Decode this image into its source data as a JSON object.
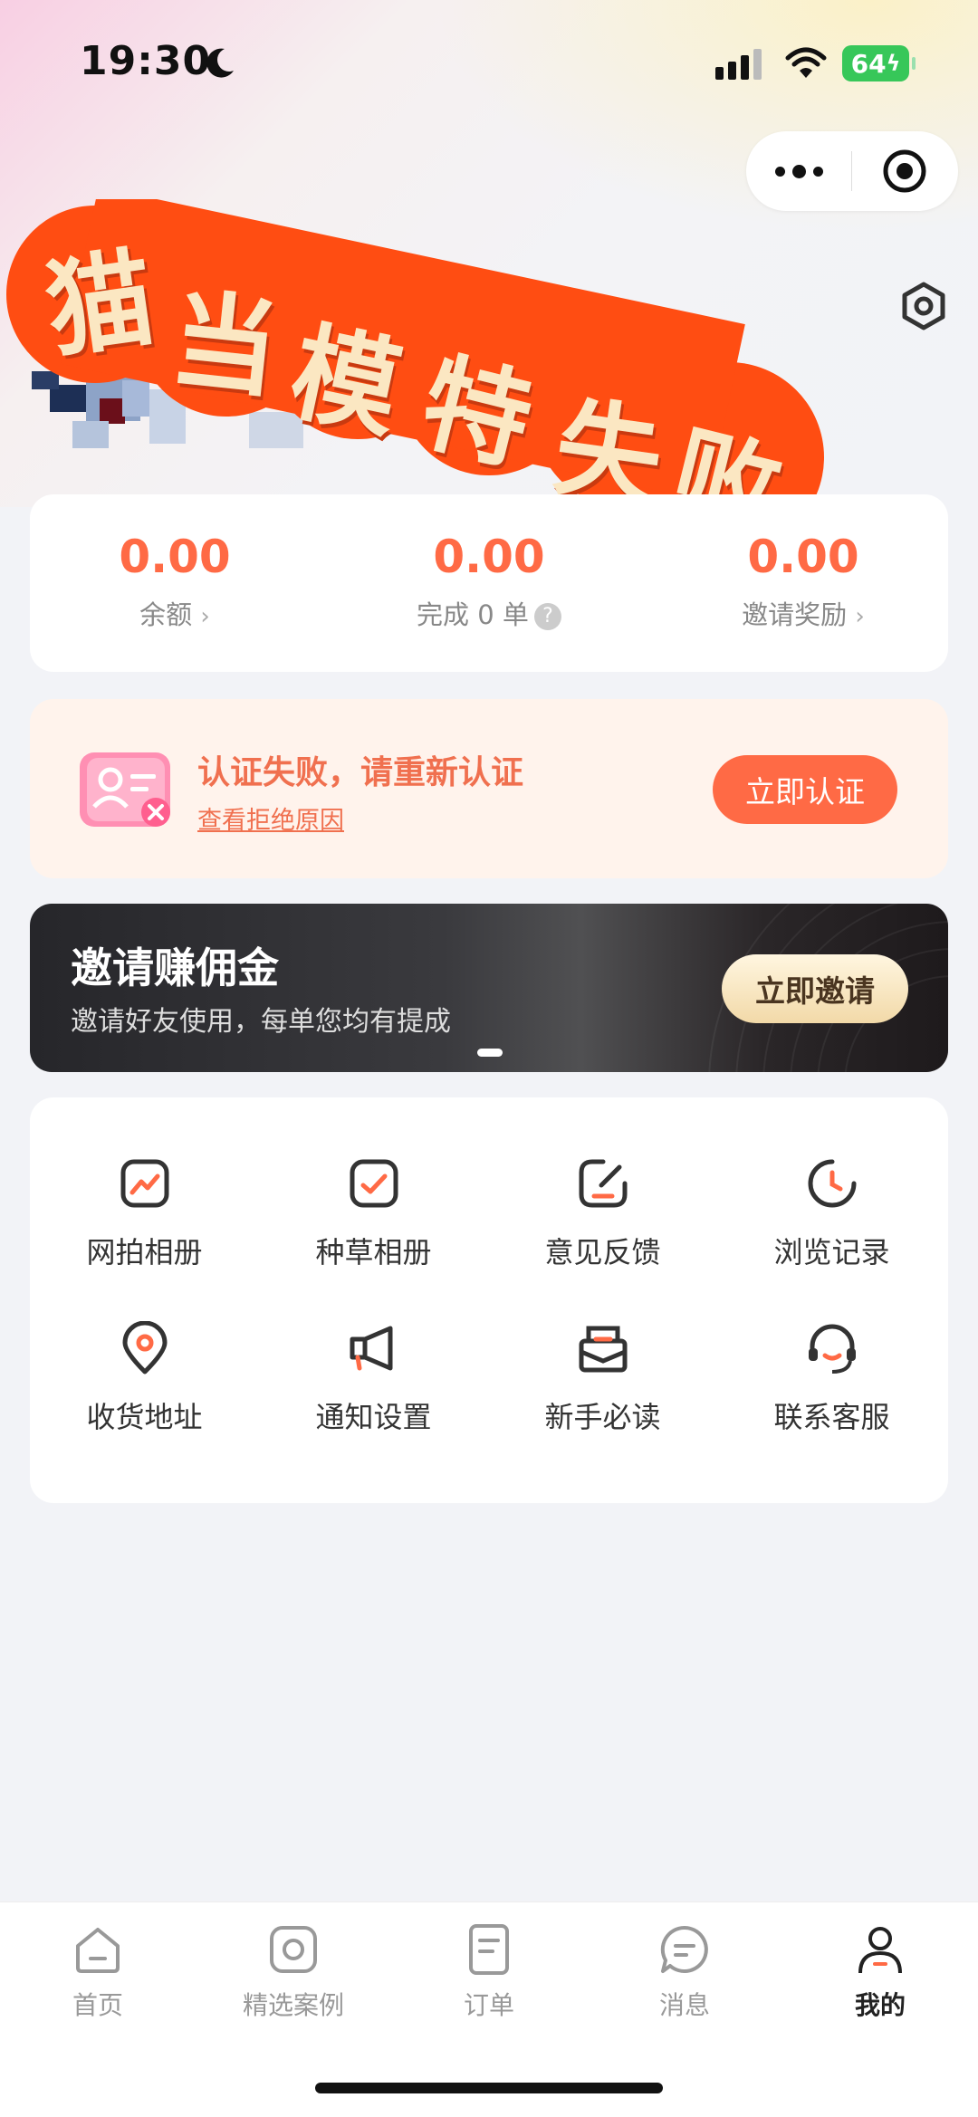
{
  "status_bar": {
    "time": "19:30",
    "battery": "64"
  },
  "capsule": {
    "more_icon": "more-dots-icon",
    "close_icon": "target-icon"
  },
  "overlay": {
    "banner_text": "猫当模特失败",
    "chars": [
      "猫",
      "当",
      "模",
      "特",
      "失",
      "败"
    ],
    "color": "#ff4d12"
  },
  "stats": [
    {
      "value": "0.00",
      "label": "余额",
      "suffix": "›"
    },
    {
      "value": "0.00",
      "label": "完成 0 单",
      "suffix": "?"
    },
    {
      "value": "0.00",
      "label": "邀请奖励",
      "suffix": "›"
    }
  ],
  "auth": {
    "title": "认证失败，请重新认证",
    "link": "查看拒绝原因",
    "button": "立即认证"
  },
  "invite": {
    "title": "邀请赚佣金",
    "subtitle": "邀请好友使用，每单您均有提成",
    "button": "立即邀请"
  },
  "grid": [
    {
      "label": "网拍相册",
      "icon": "album-photo-icon"
    },
    {
      "label": "种草相册",
      "icon": "album-check-icon"
    },
    {
      "label": "意见反馈",
      "icon": "feedback-icon"
    },
    {
      "label": "浏览记录",
      "icon": "history-clock-icon"
    },
    {
      "label": "收货地址",
      "icon": "location-pin-icon"
    },
    {
      "label": "通知设置",
      "icon": "megaphone-icon"
    },
    {
      "label": "新手必读",
      "icon": "mail-open-icon"
    },
    {
      "label": "联系客服",
      "icon": "headset-icon"
    }
  ],
  "tabs": [
    {
      "label": "首页",
      "icon": "home-icon"
    },
    {
      "label": "精选案例",
      "icon": "camera-icon"
    },
    {
      "label": "订单",
      "icon": "order-doc-icon"
    },
    {
      "label": "消息",
      "icon": "message-icon"
    },
    {
      "label": "我的",
      "icon": "profile-icon",
      "active": true
    }
  ],
  "colors": {
    "accent": "#ff6a45",
    "brand_overlay": "#ff4d12",
    "background": "#f2f3f7"
  }
}
